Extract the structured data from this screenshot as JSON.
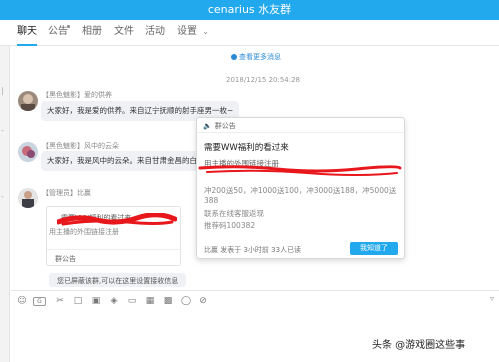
{
  "window": {
    "title": "cenarius 水友群"
  },
  "tabs": [
    {
      "label": "聊天",
      "active": true
    },
    {
      "label": "公告",
      "active": false,
      "has_dot": true
    },
    {
      "label": "相册",
      "active": false
    },
    {
      "label": "文件",
      "active": false
    },
    {
      "label": "活动",
      "active": false
    },
    {
      "label": "设置",
      "active": false,
      "has_chevron": true
    }
  ],
  "chat": {
    "history_link": "查看更多消息",
    "timestamp": "2018/12/15 20:54:28",
    "messages": [
      {
        "sender": "【黑色魅影】爱的供养",
        "text": "大家好，我是爱的供养。来自辽宁抚顺的射手座男一枚~"
      },
      {
        "sender": "【黑色魅影】风中的云朵",
        "text": "大家好，我是风中的云朵。来自甘肃金昌的白羊"
      },
      {
        "sender": "【管理员】比赢"
      }
    ],
    "quoted_notice": {
      "line1": "需要VVV福利的看过来",
      "line2": "用主播的外围链接注册",
      "footer": "群公告"
    },
    "system_tip": "您已屏蔽该群,可以在这里设置接收信息"
  },
  "announcement_popup": {
    "header": "群公告",
    "title": "需要WW福利的看过来",
    "subtitle": "用主播的外围链接注册",
    "lines": [
      "冲200送50，冲1000送100，冲3000送188，冲5000送",
      "388",
      "联系在线客服返现",
      "推荐码100382"
    ],
    "footer": "比赢  发表于 3小时前  33人已读",
    "confirm_button": "我知道了"
  },
  "toolbar": {
    "icons": [
      "smiley-icon",
      "gif-icon",
      "scissors-icon",
      "folder-icon",
      "image-icon",
      "shake-icon",
      "screen-icon",
      "document-icon",
      "box-icon",
      "mic-icon",
      "block-icon"
    ]
  },
  "watermark": "头条 @游戏圈这些事",
  "colors": {
    "accent": "#22a8ec",
    "redaction": "#e8171c"
  }
}
